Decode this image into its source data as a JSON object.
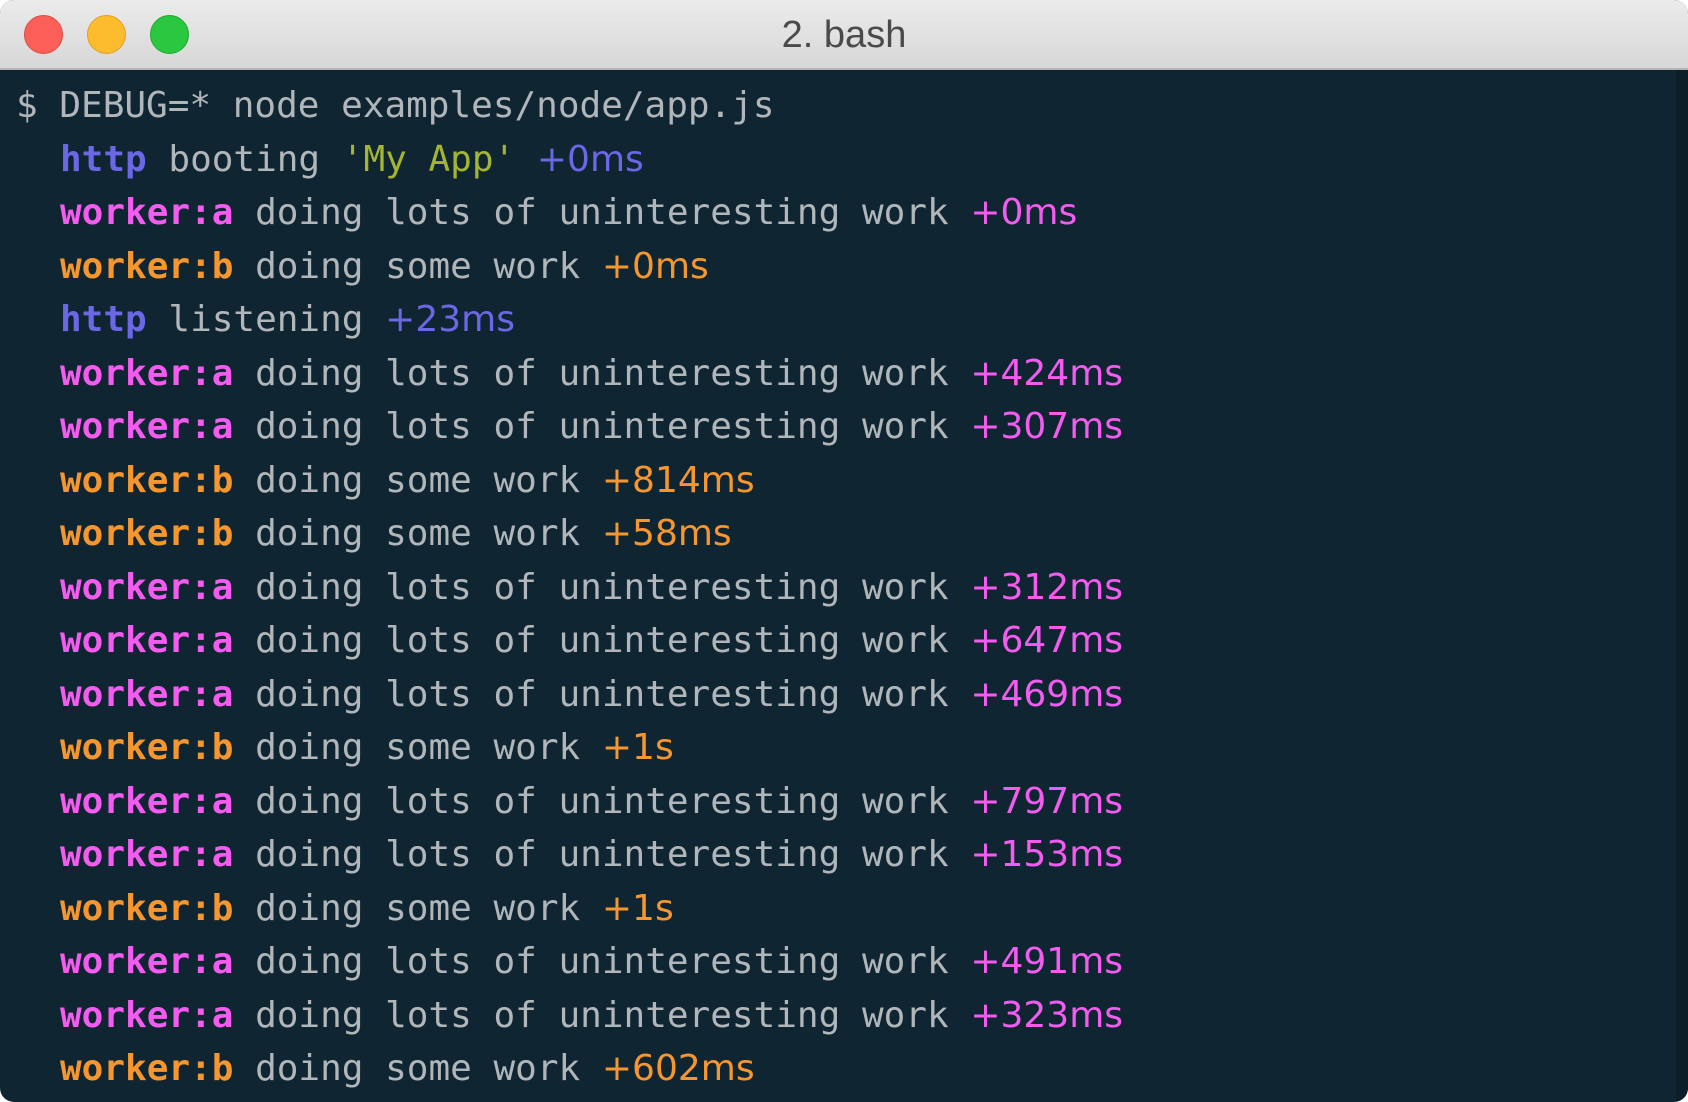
{
  "window": {
    "title": "2. bash"
  },
  "colors": {
    "background": "#0f2532",
    "text": "#b0b6ba",
    "http": "#6b67e5",
    "worker_a": "#f45cf0",
    "worker_b": "#f5962f",
    "string": "#a3b533"
  },
  "terminal": {
    "command": "$ DEBUG=* node examples/node/app.js",
    "lines": [
      {
        "ns": "http",
        "color": "#6b67e5",
        "msg": "booting",
        "str": "'My App'",
        "time": "+0ms"
      },
      {
        "ns": "worker:a",
        "color": "#f45cf0",
        "msg": "doing lots of uninteresting work",
        "time": "+0ms"
      },
      {
        "ns": "worker:b",
        "color": "#f5962f",
        "msg": "doing some work",
        "time": "+0ms"
      },
      {
        "ns": "http",
        "color": "#6b67e5",
        "msg": "listening",
        "time": "+23ms"
      },
      {
        "ns": "worker:a",
        "color": "#f45cf0",
        "msg": "doing lots of uninteresting work",
        "time": "+424ms"
      },
      {
        "ns": "worker:a",
        "color": "#f45cf0",
        "msg": "doing lots of uninteresting work",
        "time": "+307ms"
      },
      {
        "ns": "worker:b",
        "color": "#f5962f",
        "msg": "doing some work",
        "time": "+814ms"
      },
      {
        "ns": "worker:b",
        "color": "#f5962f",
        "msg": "doing some work",
        "time": "+58ms"
      },
      {
        "ns": "worker:a",
        "color": "#f45cf0",
        "msg": "doing lots of uninteresting work",
        "time": "+312ms"
      },
      {
        "ns": "worker:a",
        "color": "#f45cf0",
        "msg": "doing lots of uninteresting work",
        "time": "+647ms"
      },
      {
        "ns": "worker:a",
        "color": "#f45cf0",
        "msg": "doing lots of uninteresting work",
        "time": "+469ms"
      },
      {
        "ns": "worker:b",
        "color": "#f5962f",
        "msg": "doing some work",
        "time": "+1s"
      },
      {
        "ns": "worker:a",
        "color": "#f45cf0",
        "msg": "doing lots of uninteresting work",
        "time": "+797ms"
      },
      {
        "ns": "worker:a",
        "color": "#f45cf0",
        "msg": "doing lots of uninteresting work",
        "time": "+153ms"
      },
      {
        "ns": "worker:b",
        "color": "#f5962f",
        "msg": "doing some work",
        "time": "+1s"
      },
      {
        "ns": "worker:a",
        "color": "#f45cf0",
        "msg": "doing lots of uninteresting work",
        "time": "+491ms"
      },
      {
        "ns": "worker:a",
        "color": "#f45cf0",
        "msg": "doing lots of uninteresting work",
        "time": "+323ms"
      },
      {
        "ns": "worker:b",
        "color": "#f5962f",
        "msg": "doing some work",
        "time": "+602ms"
      }
    ]
  }
}
